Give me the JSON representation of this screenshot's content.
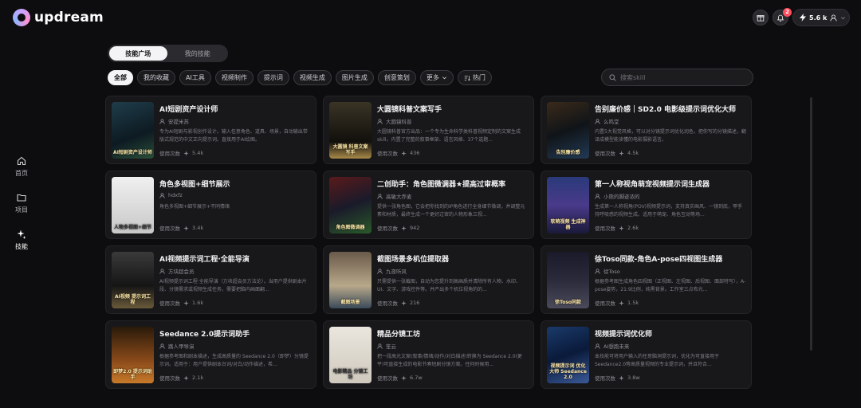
{
  "brand": {
    "name": "updream"
  },
  "header": {
    "notification_count": "2",
    "credits": "5.6 k"
  },
  "sidebar": {
    "items": [
      {
        "label": "首页",
        "icon": "home-icon"
      },
      {
        "label": "项目",
        "icon": "folder-icon"
      },
      {
        "label": "技能",
        "icon": "sparkle-icon"
      }
    ]
  },
  "tabs": [
    {
      "label": "技能广场"
    },
    {
      "label": "我的技能"
    }
  ],
  "filters": [
    {
      "label": "全部"
    },
    {
      "label": "我的收藏"
    },
    {
      "label": "AI工具"
    },
    {
      "label": "视频制作"
    },
    {
      "label": "提示词"
    },
    {
      "label": "视频生成"
    },
    {
      "label": "图片生成"
    },
    {
      "label": "创意策划"
    },
    {
      "label": "更多"
    },
    {
      "label": "热门"
    }
  ],
  "search": {
    "placeholder": "搜索skill"
  },
  "usage_label": "使用次数",
  "cards": [
    {
      "title": "AI短剧资产设计师",
      "author": "安提米苏",
      "desc": "专为AI短剧与影视创作设计。输入任意角色、道具、场景，自动输出带版式规范的中文正向提示词。直接用于AI绘图。",
      "uses": "5.4k",
      "thumb_text": "AI短剧资产设计师"
    },
    {
      "title": "大圆镜科普文案写手",
      "author": "大圆镜科普",
      "desc": "大圆镜科普官方出品：一个专为生命科学类科普视频定制的文案生成 skill。内置了完整的叙事框架、语言风格、37个选题...",
      "uses": "436",
      "thumb_text": "大圆镜 科普文案写手"
    },
    {
      "title": "告别廉价感｜SD2.0 电影级提示词优化大师",
      "author": "么鸣堂",
      "desc": "内置5大视觉风格，可以对分镜提示词优化润色，把你写的分镜描述，翻译成模型能读懂的电影摄影语言。",
      "uses": "4.5k",
      "thumb_text": "告别廉价感"
    },
    {
      "title": "角色多视图+细节展示",
      "author": "hdxfz",
      "desc": "角色多视图+细节展示+不同情绪",
      "uses": "3.4k",
      "thumb_text": "人物多视图+细节"
    },
    {
      "title": "二创助手：角色图微调器★提高过审概率",
      "author": "高敏大乔麦",
      "desc": "提供一张角色图，它会把你找到的IP角色进行全身细节微调，并调整元素和材质，最终生成一个更好过审的人物形象三视...",
      "uses": "942",
      "thumb_text": "角色图微调器"
    },
    {
      "title": "第一人称视角萌宠视频提示词生成器",
      "author": "小熊的脚迹浓的",
      "desc": "生成第一人称视角(POV)视频提示词，支持真实画风、一镜到底，甲手持呼吸感的视频生成。适用于萌宠、角色互动等场...",
      "uses": "2.6k",
      "thumb_text": "软萌视频 生成神器"
    },
    {
      "title": "AI视频提示词工程·全能导演",
      "author": "方块超会员",
      "desc": "AI视频提示词工程·全能导演（方块超会员方法论）。当用户提供剧本片段、分镜需求或视频生成任务，需要把脑内画面翻...",
      "uses": "1.6k",
      "thumb_text": "AI视频 提示词工程"
    },
    {
      "title": "截图场景多机位提取器",
      "author": "九夜听风",
      "desc": "只需提供一张截图，自动为您提升到高画质并清除所有人物、水印、UI、文字、游戏控件等。并产出多个机位视角的的...",
      "uses": "216",
      "thumb_text": "截图场景"
    },
    {
      "title": "徐Toso同款-角色A-pose四视图生成器",
      "author": "徐Toso",
      "desc": "根据参考图生成角色四视图（正视图、左视图、后视图、面部特写），A-pose姿势，21:9比例，纯黑背景。工作室三点布光...",
      "uses": "1.5k",
      "thumb_text": "徐Toso同款"
    },
    {
      "title": "Seedance 2.0提示词助手",
      "author": "路人甲导演",
      "desc": "根据参考图和剧本描述，生成高质量的 Seedance 2.0（即梦）分镜提示词。适用于：用户提供剧本台词/对白/动作描述，希...",
      "uses": "2.1k",
      "thumb_text": "即梦2.0 提示词助手"
    },
    {
      "title": "精品分镜工坊",
      "author": "笙云",
      "desc": "把一段高光文案(叙事/情绪/动作/对白描述)转换为 Seedance 2.0(更平)可直接生成的电影节奏短剧分镜方案。任何时候用...",
      "uses": "6.7w",
      "thumb_text": "电影精品 分镜工坊"
    },
    {
      "title": "视频提示词优化师",
      "author": "AI想跑未来",
      "desc": "本技能可将用户输入的任意脑洞提示词，优化为可直接用于Seedance2.0等高质量视频的专业提示词，并且符合...",
      "uses": "3.8w",
      "thumb_text": "视频提示词 优化大师 Seedance 2.0"
    }
  ],
  "colors": {
    "background": "#0d0d0f",
    "card": "#18181b",
    "accent_badge": "#ff4d5e",
    "chip_active": "#f4f4f6"
  }
}
